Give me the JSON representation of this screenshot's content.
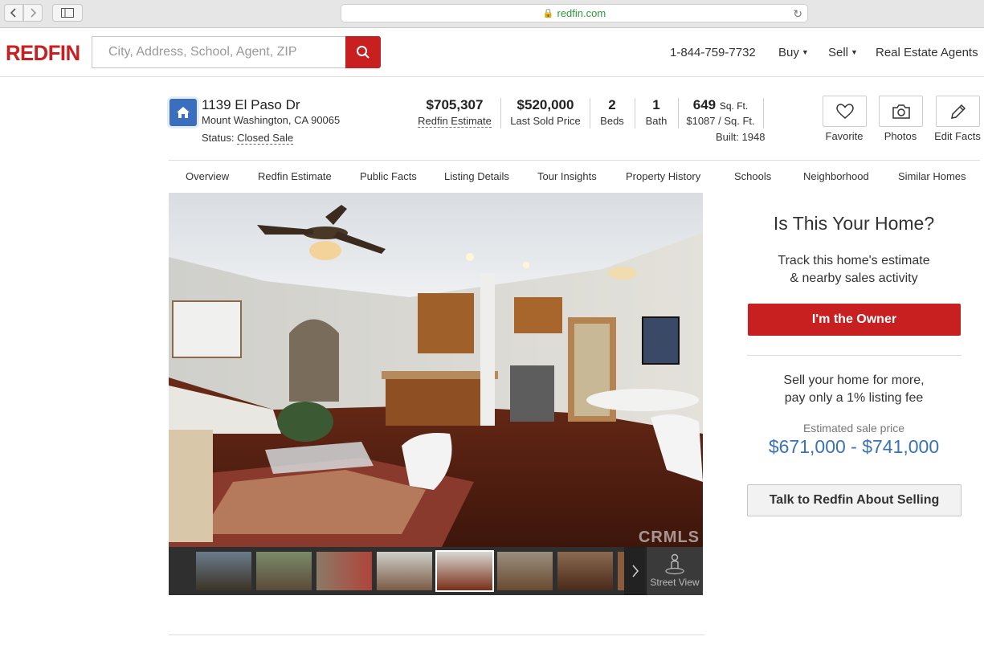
{
  "browser": {
    "url": "redfin.com"
  },
  "header": {
    "logo": "REDFIN",
    "search_placeholder": "City, Address, School, Agent, ZIP",
    "phone": "1-844-759-7732",
    "nav": [
      "Buy",
      "Sell",
      "Real Estate Agents"
    ]
  },
  "property": {
    "street": "1139 El Paso Dr",
    "city": "Mount Washington, CA 90065",
    "status_label": "Status:",
    "status_value": "Closed Sale",
    "estimate_value": "$705,307",
    "estimate_label": "Redfin Estimate",
    "sold_value": "$520,000",
    "sold_label": "Last Sold Price",
    "beds_value": "2",
    "beds_label": "Beds",
    "bath_value": "1",
    "bath_label": "Bath",
    "sqft_value": "649",
    "sqft_unit": "Sq. Ft.",
    "price_per_sqft": "$1087 / Sq. Ft.",
    "built": "Built: 1948"
  },
  "actions": [
    "Favorite",
    "Photos",
    "Edit Facts"
  ],
  "tabs": [
    "Overview",
    "Redfin Estimate",
    "Public Facts",
    "Listing Details",
    "Tour Insights",
    "Property History",
    "Schools",
    "Neighborhood",
    "Similar Homes"
  ],
  "photo": {
    "watermark": "CRMLS",
    "street_view_label": "Street View"
  },
  "owner_panel": {
    "title": "Is This Your Home?",
    "subtitle_line1": "Track this home's estimate",
    "subtitle_line2": "& nearby sales activity",
    "owner_button": "I'm the Owner",
    "sell_line1": "Sell your home for more,",
    "sell_line2": "pay only a 1% listing fee",
    "estimate_label": "Estimated sale price",
    "estimate_range": "$671,000 - $741,000",
    "talk_button": "Talk to Redfin About Selling"
  },
  "colors": {
    "brand_red": "#c82021",
    "link_blue": "#3a72b8",
    "home_icon_blue": "#3a6fbf"
  }
}
